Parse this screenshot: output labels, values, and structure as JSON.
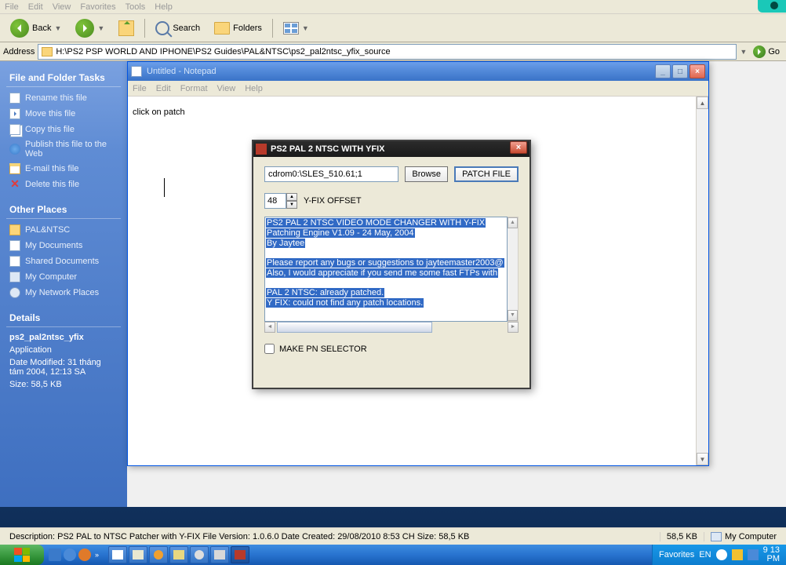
{
  "menubar": {
    "file": "File",
    "edit": "Edit",
    "view": "View",
    "favorites": "Favorites",
    "tools": "Tools",
    "help": "Help"
  },
  "toolbar": {
    "back": "Back",
    "search": "Search",
    "folders": "Folders"
  },
  "addressbar": {
    "label": "Address",
    "path": "H:\\PS2 PSP WORLD AND IPHONE\\PS2 Guides\\PAL&NTSC\\ps2_pal2ntsc_yfix_source",
    "go": "Go"
  },
  "sidebar": {
    "tasks_header": "File and Folder Tasks",
    "tasks": [
      {
        "label": "Rename this file",
        "icon": "si-rename"
      },
      {
        "label": "Move this file",
        "icon": "si-move"
      },
      {
        "label": "Copy this file",
        "icon": "si-copy"
      },
      {
        "label": "Publish this file to the Web",
        "icon": "si-publish"
      },
      {
        "label": "E-mail this file",
        "icon": "si-email"
      },
      {
        "label": "Delete this file",
        "icon": "si-delete",
        "glyph": "✕"
      }
    ],
    "other_header": "Other Places",
    "other": [
      {
        "label": "PAL&NTSC",
        "icon": "si-folder"
      },
      {
        "label": "My Documents",
        "icon": "si-docs"
      },
      {
        "label": "Shared Documents",
        "icon": "si-docs"
      },
      {
        "label": "My Computer",
        "icon": "si-computer"
      },
      {
        "label": "My Network Places",
        "icon": "si-network"
      }
    ],
    "details_header": "Details",
    "details": {
      "name": "ps2_pal2ntsc_yfix",
      "type": "Application",
      "modified": "Date Modified: 31 tháng tám 2004, 12:13 SA",
      "size": "Size: 58,5 KB"
    }
  },
  "notepad": {
    "title": "Untitled - Notepad",
    "menu": {
      "file": "File",
      "edit": "Edit",
      "format": "Format",
      "view": "View",
      "help": "Help"
    },
    "content": "click on patch"
  },
  "patcher": {
    "title": "PS2 PAL 2 NTSC WITH YFIX",
    "path": "cdrom0:\\SLES_510.61;1",
    "browse": "Browse",
    "patch": "PATCH FILE",
    "offset": "48",
    "offset_label": "Y-FIX OFFSET",
    "log": [
      "PS2 PAL 2 NTSC VIDEO MODE CHANGER WITH Y-FIX",
      "Patching Engine V1.09 - 24 May, 2004",
      "By Jaytee",
      "",
      "Please report any bugs or suggestions to jayteemaster2003@",
      "Also, I would appreciate if you send me some fast FTPs with",
      "",
      "PAL 2 NTSC: already patched.",
      "Y FIX: could not find any patch locations."
    ],
    "checkbox": "MAKE PN SELECTOR"
  },
  "statusbar": {
    "desc": "Description: PS2 PAL to NTSC Patcher with Y-FIX File Version: 1.0.6.0 Date Created: 29/08/2010 8:53 CH Size: 58,5 KB",
    "size": "58,5 KB",
    "location": "My Computer"
  },
  "tray": {
    "favorites": "Favorites",
    "lang": "EN",
    "time_top": "9 13",
    "time_bot": "PM"
  }
}
